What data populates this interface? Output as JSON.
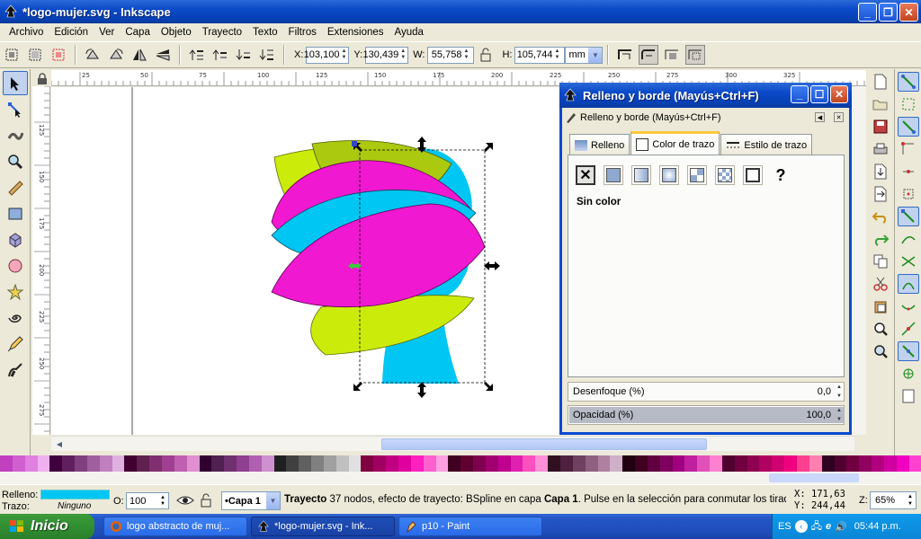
{
  "window": {
    "title": "*logo-mujer.svg - Inkscape",
    "icon": "inkscape-icon"
  },
  "menu": [
    "Archivo",
    "Edición",
    "Ver",
    "Capa",
    "Objeto",
    "Trayecto",
    "Texto",
    "Filtros",
    "Extensiones",
    "Ayuda"
  ],
  "toolbar": {
    "x_label": "X:",
    "x_value": "103,100",
    "y_label": "Y:",
    "y_value": "130,439",
    "w_label": "W:",
    "w_value": "55,758",
    "h_label": "H:",
    "h_value": "105,744",
    "unit": "mm"
  },
  "ruler": {
    "h_ticks": [
      "25",
      "50",
      "75",
      "100",
      "125",
      "150",
      "175",
      "200",
      "225",
      "250",
      "275",
      "300",
      "325"
    ],
    "v_ticks": [
      "125",
      "150",
      "175",
      "200",
      "225",
      "250",
      "275",
      "300"
    ]
  },
  "dialog": {
    "title": "Relleno y borde (Mayús+Ctrl+F)",
    "subtitle": "Relleno y borde (Mayús+Ctrl+F)",
    "tabs": [
      "Relleno",
      "Color de trazo",
      "Estilo de trazo"
    ],
    "active_tab": "Color de trazo",
    "paint_mode": "Sin color",
    "blur_label": "Desenfoque (%)",
    "blur_value": "0,0",
    "opacity_label": "Opacidad (%)",
    "opacity_value": "100,0",
    "opacity_level": 1.0
  },
  "palette": [
    "#c040c0",
    "#d060d0",
    "#e080e0",
    "#f0b0f0",
    "#400040",
    "#602060",
    "#804080",
    "#a060a0",
    "#c080c0",
    "#e0b0e0",
    "#400030",
    "#602050",
    "#803070",
    "#a04090",
    "#c060b0",
    "#e090d0",
    "#300030",
    "#502050",
    "#703070",
    "#904090",
    "#b060b0",
    "#d090d0",
    "#202020",
    "#404040",
    "#606060",
    "#808080",
    "#a0a0a0",
    "#c0c0c0",
    "#e0e0e0",
    "#800040",
    "#a00060",
    "#c00080",
    "#e000a0",
    "#ff20c0",
    "#ff60d0",
    "#ffa0e0",
    "#400020",
    "#600030",
    "#800050",
    "#a00070",
    "#c00090",
    "#e020b0",
    "#ff50c0",
    "#ff90d8",
    "#301020",
    "#502040",
    "#704060",
    "#906080",
    "#b080a0",
    "#d0b0c8",
    "#200010",
    "#400020",
    "#600040",
    "#800060",
    "#a00080",
    "#c020a0",
    "#e050b8",
    "#ff80d0",
    "#500030",
    "#700040",
    "#900050",
    "#b00060",
    "#d00070",
    "#f00080",
    "#ff4090",
    "#ff80b0",
    "#300020",
    "#500030",
    "#700040",
    "#900060",
    "#b00080",
    "#d000a0",
    "#f000c0",
    "#ff40d0"
  ],
  "status": {
    "fill_label": "Relleno:",
    "stroke_label": "Trazo:",
    "fill_color": "#00c6f4",
    "stroke_value": "Ninguno",
    "opacity_label": "O:",
    "opacity_value": "100",
    "layer": "•Capa 1",
    "message_bold": "Trayecto",
    "message": " 37 nodos, efecto de trayecto: BSpline en capa ",
    "message_layer": "Capa 1",
    "message_end": ". Pulse en la selección para conmutar los tiradore...",
    "x_label": "X:",
    "x_value": "171,63",
    "y_label": "Y:",
    "y_value": "244,44",
    "zoom_label": "Z:",
    "zoom_value": "65%"
  },
  "taskbar": {
    "start": "Inicio",
    "tasks": [
      {
        "label": "logo abstracto de muj...",
        "icon": "firefox-icon"
      },
      {
        "label": "*logo-mujer.svg - Ink...",
        "icon": "inkscape-icon"
      },
      {
        "label": "p10 - Paint",
        "icon": "paint-icon"
      }
    ],
    "lang": "ES",
    "clock": "05:44 p.m."
  }
}
